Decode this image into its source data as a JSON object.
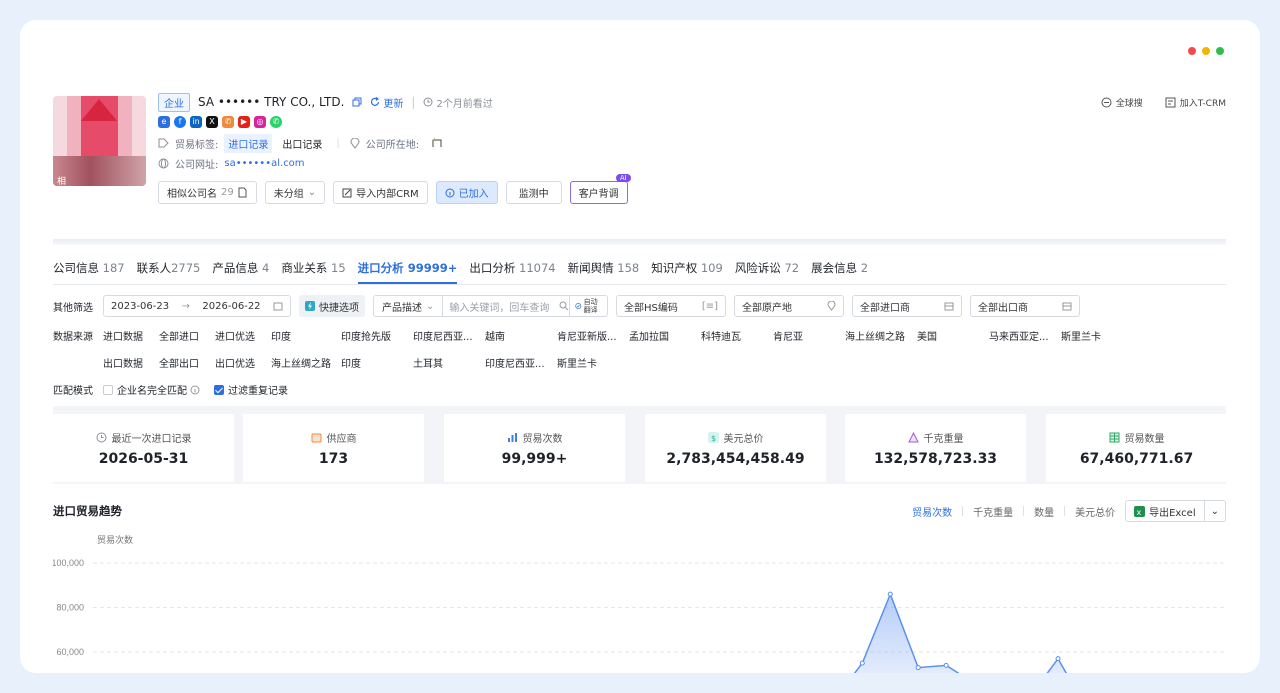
{
  "window": {
    "dots": [
      "#f04a4a",
      "#f5b400",
      "#2fbe4c"
    ]
  },
  "header": {
    "logo_label": "相",
    "tag": "企业",
    "company_name": "SA •••••• TRY CO., LTD.",
    "update_label": "更新",
    "seen_label": "2个月前看过",
    "global_search": "全球搜",
    "add_tcrm": "加入T-CRM",
    "trade_tag_label": "贸易标签:",
    "trade_tags": [
      "进口记录",
      "出口记录"
    ],
    "location_label": "公司所在地:",
    "location_value": "",
    "website_label": "公司网址:",
    "website_value": "sa••••••al.com",
    "buttons": {
      "similar": "相似公司名",
      "similar_count": "29",
      "group": "未分组",
      "import_crm": "导入内部CRM",
      "joined": "已加入",
      "monitor": "监测中",
      "background": "客户背调",
      "ai_badge": "AI"
    }
  },
  "tabs": [
    {
      "label": "公司信息",
      "count": "187"
    },
    {
      "label": "联系人",
      "count": "2775"
    },
    {
      "label": "产品信息",
      "count": "4"
    },
    {
      "label": "商业关系",
      "count": "15"
    },
    {
      "label": "进口分析",
      "count": "99999+"
    },
    {
      "label": "出口分析",
      "count": "11074"
    },
    {
      "label": "新闻舆情",
      "count": "158"
    },
    {
      "label": "知识产权",
      "count": "109"
    },
    {
      "label": "风险诉讼",
      "count": "72"
    },
    {
      "label": "展会信息",
      "count": "2"
    }
  ],
  "filters": {
    "other_label": "其他筛选",
    "date_start": "2023-06-23",
    "date_arrow": "→",
    "date_end": "2026-06-22",
    "quick": "快捷选项",
    "product_desc": "产品描述",
    "keyword_placeholder": "输入关键词，回车查询",
    "auto_translate": "自动翻译",
    "hs_code": "全部HS编码",
    "origin": "全部原产地",
    "importer": "全部进口商",
    "exporter": "全部出口商",
    "source_label": "数据来源",
    "import_sources": [
      "进口数据",
      "全部进口",
      "进口优选",
      "印度",
      "印度抢先版",
      "印度尼西亚...",
      "越南",
      "肯尼亚新版...",
      "孟加拉国",
      "科特迪瓦",
      "肯尼亚",
      "海上丝绸之路",
      "美国",
      "马来西亚定...",
      "斯里兰卡"
    ],
    "export_sources": [
      "出口数据",
      "全部出口",
      "出口优选",
      "海上丝绸之路",
      "印度",
      "",
      "土耳其",
      "",
      "印度尼西亚...",
      "斯里兰卡"
    ],
    "match_label": "匹配模式",
    "exact_match": "企业名完全匹配",
    "filter_dup": "过滤重复记录"
  },
  "stats": [
    {
      "title": "最近一次进口记录",
      "value": "2026-05-31",
      "color": "#8a9099"
    },
    {
      "title": "供应商",
      "value": "173",
      "color": "#f08a3c"
    },
    {
      "title": "贸易次数",
      "value": "99,999+",
      "color": "#3d7fe6"
    },
    {
      "title": "美元总价",
      "value": "2,783,454,458.49",
      "color": "#1fb5a0"
    },
    {
      "title": "千克重量",
      "value": "132,578,723.33",
      "color": "#9b59e0"
    },
    {
      "title": "贸易数量",
      "value": "67,460,771.67",
      "color": "#2fa96a"
    }
  ],
  "trend": {
    "title": "进口贸易趋势",
    "metrics": [
      "贸易次数",
      "千克重量",
      "数量",
      "美元总价"
    ],
    "export_label": "导出Excel"
  },
  "chart_data": {
    "type": "area",
    "ylabel": "贸易次数",
    "y_ticks": [
      "100,000",
      "80,000",
      "60,000"
    ],
    "ylim": [
      40000,
      100000
    ],
    "values": [
      0,
      0,
      0,
      0,
      0,
      0,
      0,
      0,
      0,
      0,
      0,
      0,
      0,
      0,
      0,
      0,
      0,
      0,
      0,
      0,
      55000,
      86000,
      53000,
      54000,
      46000,
      35000,
      40000,
      57000,
      35000
    ],
    "grid": true,
    "accent": "#5b8ff0"
  }
}
